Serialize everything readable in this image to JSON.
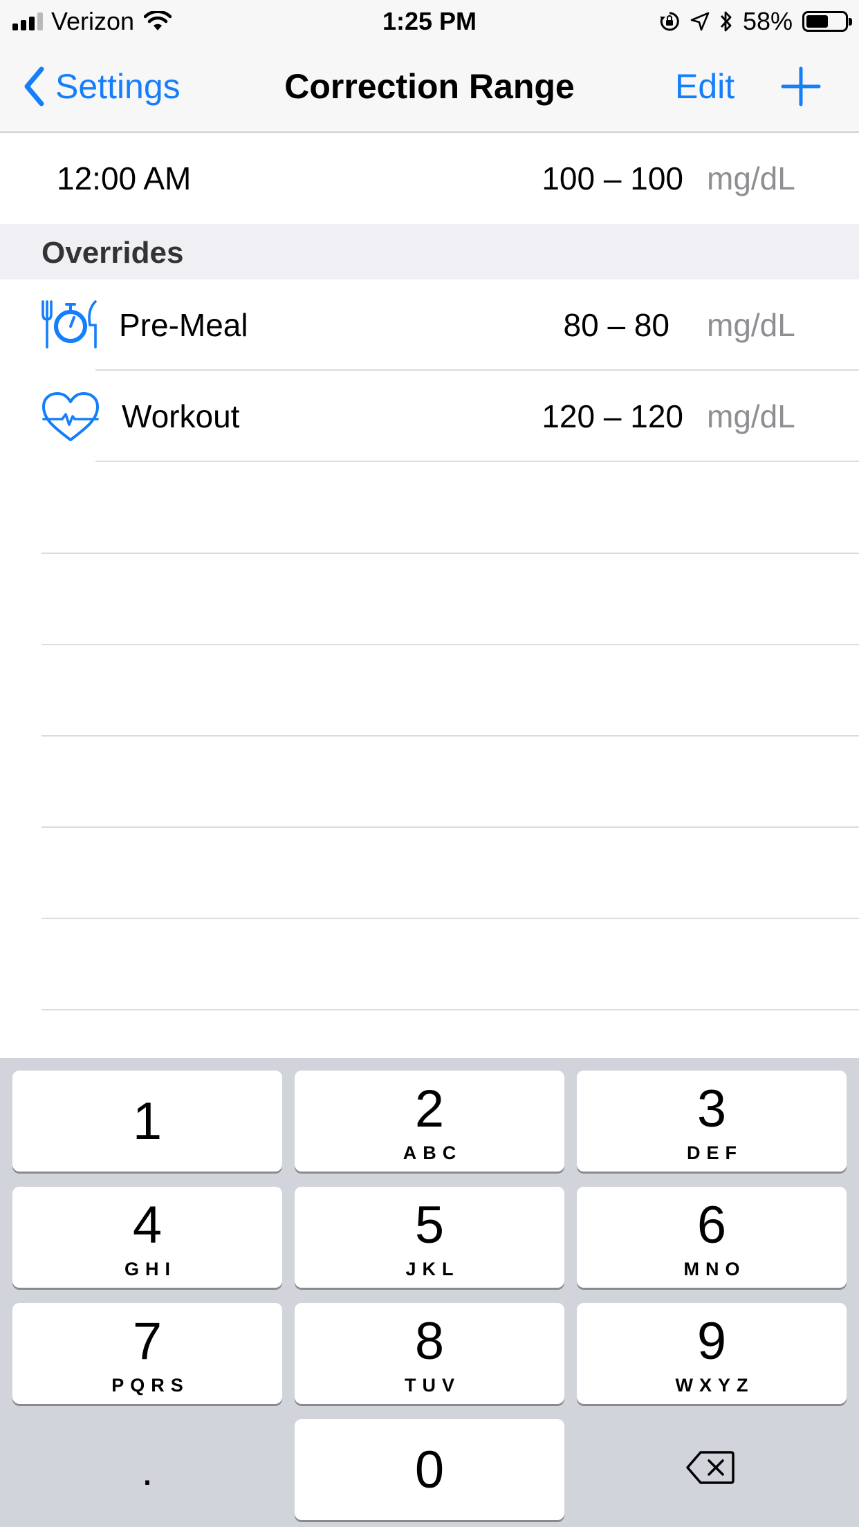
{
  "status_bar": {
    "carrier": "Verizon",
    "time": "1:25 PM",
    "battery_percent_text": "58%",
    "battery_level": 0.58,
    "icons": [
      "signal-icon",
      "wifi-icon",
      "orientation-lock-icon",
      "location-icon",
      "bluetooth-icon",
      "battery-icon"
    ]
  },
  "nav": {
    "back_label": "Settings",
    "title": "Correction Range",
    "edit_label": "Edit",
    "add_icon": "plus-icon",
    "accent_color": "#157efb"
  },
  "schedule": [
    {
      "time": "12:00 AM",
      "range": "100 – 100",
      "unit": "mg/dL"
    }
  ],
  "overrides": {
    "header": "Overrides",
    "items": [
      {
        "label": "Pre-Meal",
        "range": "80 – 80",
        "unit": "mg/dL",
        "icon": "pre-meal-icon"
      },
      {
        "label": "Workout",
        "range": "120 – 120",
        "unit": "mg/dL",
        "icon": "workout-heart-icon"
      }
    ]
  },
  "keypad": {
    "keys": [
      {
        "digit": "1",
        "letters": ""
      },
      {
        "digit": "2",
        "letters": "ABC"
      },
      {
        "digit": "3",
        "letters": "DEF"
      },
      {
        "digit": "4",
        "letters": "GHI"
      },
      {
        "digit": "5",
        "letters": "JKL"
      },
      {
        "digit": "6",
        "letters": "MNO"
      },
      {
        "digit": "7",
        "letters": "PQRS"
      },
      {
        "digit": "8",
        "letters": "TUV"
      },
      {
        "digit": "9",
        "letters": "WXYZ"
      },
      {
        "digit": "0",
        "letters": ""
      }
    ],
    "decimal_label": ".",
    "delete_icon": "delete-backspace-icon"
  }
}
